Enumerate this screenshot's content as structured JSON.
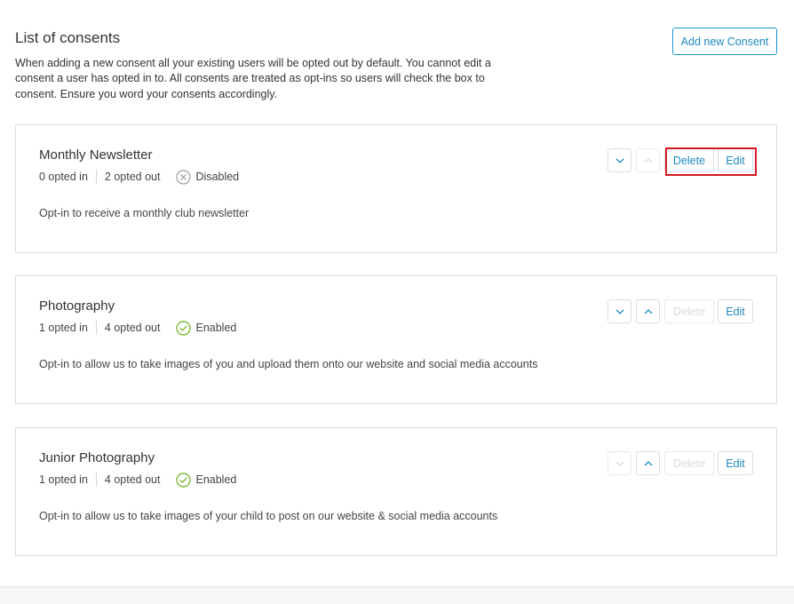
{
  "header": {
    "title": "List of consents",
    "description": "When adding a new consent all your existing users will be opted out by default. You cannot edit a consent a user has opted in to. All consents are treated as opt-ins so users will check the box to consent. Ensure you word your consents accordingly.",
    "add_button": "Add new Consent"
  },
  "consents": [
    {
      "title": "Monthly Newsletter",
      "opted_in": "0 opted in",
      "opted_out": "2 opted out",
      "status": "Disabled",
      "description": "Opt-in to receive a monthly club newsletter",
      "delete_label": "Delete",
      "edit_label": "Edit"
    },
    {
      "title": "Photography",
      "opted_in": "1 opted in",
      "opted_out": "4 opted out",
      "status": "Enabled",
      "description": "Opt-in to allow us to take images of you and upload them onto our website and social media accounts",
      "delete_label": "Delete",
      "edit_label": "Edit"
    },
    {
      "title": "Junior Photography",
      "opted_in": "1 opted in",
      "opted_out": "4 opted out",
      "status": "Enabled",
      "description": "Opt-in to allow us to take images of your child to post on our website & social media accounts",
      "delete_label": "Delete",
      "edit_label": "Edit"
    }
  ],
  "colors": {
    "accent": "#1c8ac0",
    "enabled": "#7cb83a",
    "disabled": "#a0a0a0",
    "highlight": "#d7191f"
  }
}
